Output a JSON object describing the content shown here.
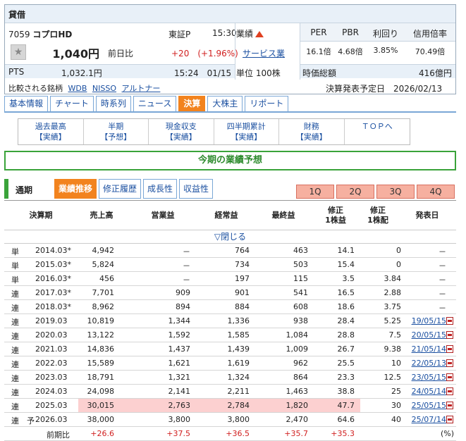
{
  "stock": {
    "tag": "貸借",
    "code": "7059",
    "name": "コプロHD",
    "market": "東証P",
    "time": "15:30",
    "price": "1,040円",
    "diff_label": "前日比",
    "diff": "+20　(+1.96%)",
    "pts_label": "PTS",
    "pts_price": "1,032.1円",
    "pts_time": "15:24　01/15",
    "compare_label": "比較される銘柄",
    "compare": [
      "WDB",
      "NISSO",
      "アルトナー"
    ],
    "gyoseki_label": "業績",
    "sector": "サービス業",
    "unit": "単位 100株",
    "metric_labels": [
      "PER",
      "PBR",
      "利回り",
      "信用倍率"
    ],
    "metric_values": [
      "16.1倍",
      "4.68倍",
      "3.85%",
      "70.49倍"
    ],
    "mcap_label": "時価総額",
    "mcap_value": "416億円",
    "kessan_date": "決算発表予定日　2026/02/13"
  },
  "tabs": [
    "基本情報",
    "チャート",
    "時系列",
    "ニュース",
    "決算",
    "大株主",
    "リポート"
  ],
  "active_tab": "決算",
  "subnav": [
    {
      "title": "過去最高",
      "sub": "【実績】"
    },
    {
      "title": "半期",
      "sub": "【予想】"
    },
    {
      "title": "現金収支",
      "sub": "【実績】"
    },
    {
      "title": "四半期累計",
      "sub": "【実績】"
    },
    {
      "title": "財務",
      "sub": "【実績】"
    },
    {
      "title": "ＴＯＰへ",
      "sub": ""
    }
  ],
  "section_title": "今期の業績予想",
  "period_label": "通期",
  "subtabs": [
    "業績推移",
    "修正履歴",
    "成長性",
    "収益性"
  ],
  "quarter_tabs": [
    "1Q",
    "2Q",
    "3Q",
    "4Q"
  ],
  "headers": {
    "period": "決算期",
    "sales": "売上高",
    "op": "営業益",
    "ord": "経常益",
    "net": "最終益",
    "eps": "修正\n1株益",
    "div": "修正\n1株配",
    "date": "発表日"
  },
  "toggle": "▽閉じる",
  "rows": [
    {
      "type": "単",
      "period": "2014.03*",
      "sales": "4,942",
      "op": "－",
      "ord": "764",
      "net": "463",
      "eps": "14.1",
      "div": "0",
      "date": "－",
      "link": false
    },
    {
      "type": "単",
      "period": "2015.03*",
      "sales": "5,824",
      "op": "－",
      "ord": "734",
      "net": "503",
      "eps": "15.4",
      "div": "0",
      "date": "－",
      "link": false
    },
    {
      "type": "単",
      "period": "2016.03*",
      "sales": "456",
      "op": "－",
      "ord": "197",
      "net": "115",
      "eps": "3.5",
      "div": "3.84",
      "date": "－",
      "link": false
    },
    {
      "type": "連",
      "period": "2017.03*",
      "sales": "7,701",
      "op": "909",
      "ord": "901",
      "net": "541",
      "eps": "16.5",
      "div": "2.88",
      "date": "－",
      "link": false
    },
    {
      "type": "連",
      "period": "2018.03*",
      "sales": "8,962",
      "op": "894",
      "ord": "884",
      "net": "608",
      "eps": "18.6",
      "div": "3.75",
      "date": "－",
      "link": false
    },
    {
      "type": "連",
      "period": "2019.03",
      "sales": "10,819",
      "op": "1,344",
      "ord": "1,336",
      "net": "938",
      "eps": "28.4",
      "div": "5.25",
      "date": "19/05/15",
      "link": true
    },
    {
      "type": "連",
      "period": "2020.03",
      "sales": "13,122",
      "op": "1,592",
      "ord": "1,585",
      "net": "1,084",
      "eps": "28.8",
      "div": "7.5",
      "date": "20/05/15",
      "link": true
    },
    {
      "type": "連",
      "period": "2021.03",
      "sales": "14,836",
      "op": "1,437",
      "ord": "1,439",
      "net": "1,009",
      "eps": "26.7",
      "div": "9.38",
      "date": "21/05/14",
      "link": true
    },
    {
      "type": "連",
      "period": "2022.03",
      "sales": "15,589",
      "op": "1,621",
      "ord": "1,619",
      "net": "962",
      "eps": "25.5",
      "div": "10",
      "date": "22/05/13",
      "link": true
    },
    {
      "type": "連",
      "period": "2023.03",
      "sales": "18,791",
      "op": "1,321",
      "ord": "1,324",
      "net": "864",
      "eps": "23.3",
      "div": "12.5",
      "date": "23/05/15",
      "link": true
    },
    {
      "type": "連",
      "period": "2024.03",
      "sales": "24,098",
      "op": "2,141",
      "ord": "2,211",
      "net": "1,463",
      "eps": "38.8",
      "div": "25",
      "date": "24/05/14",
      "link": true
    },
    {
      "type": "連",
      "period": "2025.03",
      "sales": "30,015",
      "op": "2,763",
      "ord": "2,784",
      "net": "1,820",
      "eps": "47.7",
      "div": "30",
      "date": "25/05/15",
      "link": true,
      "highlight": true
    },
    {
      "type": "連　予",
      "period": "2026.03",
      "sales": "38,000",
      "op": "3,800",
      "ord": "3,800",
      "net": "2,470",
      "eps": "64.6",
      "div": "40",
      "date": "25/07/14",
      "link": true
    }
  ],
  "yoy": {
    "label": "前期比",
    "sales": "+26.6",
    "op": "+37.5",
    "ord": "+36.5",
    "net": "+35.7",
    "eps": "+35.3",
    "unit": "(%)"
  }
}
